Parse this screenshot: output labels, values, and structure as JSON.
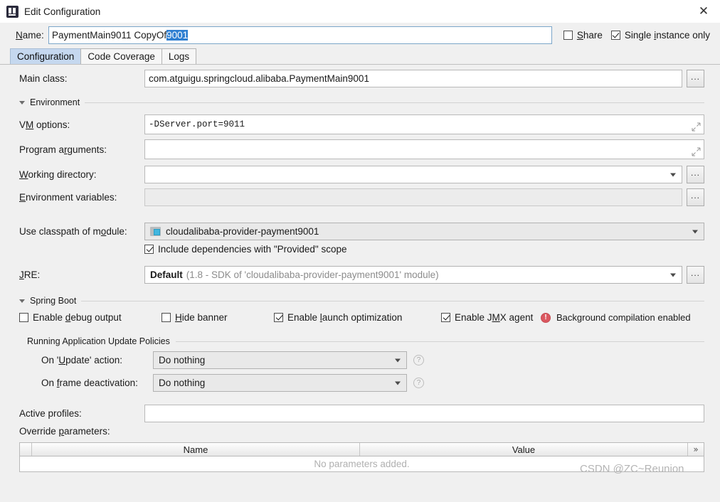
{
  "window": {
    "title": "Edit Configuration",
    "app_icon": "intellij-idea-icon",
    "close_label": "✕"
  },
  "name_row": {
    "label": "Name:",
    "value_plain": "PaymentMain9011 CopyOf ",
    "value_selected": "9001",
    "share": {
      "label": "Share",
      "mnemonic": "S",
      "checked": false
    },
    "single_instance": {
      "label": "Single instance only",
      "pre": "Single ",
      "mnemonic": "i",
      "post": "nstance only",
      "checked": true
    }
  },
  "tabs": [
    {
      "label": "Configuration",
      "active": true
    },
    {
      "label": "Code Coverage",
      "active": false
    },
    {
      "label": "Logs",
      "active": false
    }
  ],
  "fields": {
    "main_class": {
      "label": "Main class:",
      "value": "com.atguigu.springcloud.alibaba.PaymentMain9001",
      "browse": "..."
    },
    "vm_options": {
      "label_pre": "V",
      "label_mn": "M",
      "label_post": " options:",
      "label": "VM options:",
      "value": "-DServer.port=9011",
      "expand_icon": "expand-icon"
    },
    "program_arguments": {
      "label_pre": "Program a",
      "label_mn": "r",
      "label_post": "guments:",
      "label": "Program arguments:",
      "value": "",
      "expand_icon": "expand-icon"
    },
    "working_directory": {
      "label_pre": "",
      "label_mn": "W",
      "label_post": "orking directory:",
      "label": "Working directory:",
      "value": "",
      "browse": "..."
    },
    "environment_variables": {
      "label_pre": "",
      "label_mn": "E",
      "label_post": "nvironment variables:",
      "label": "Environment variables:",
      "value": "",
      "browse": "...",
      "disabled": true
    },
    "classpath_module": {
      "label_pre": "Use classpath of m",
      "label_mn": "o",
      "label_post": "dule:",
      "label": "Use classpath of module:",
      "value": "cloudalibaba-provider-payment9001",
      "icon": "module-icon"
    },
    "include_provided": {
      "label": "Include dependencies with \"Provided\" scope",
      "checked": true
    },
    "jre": {
      "label_pre": "",
      "label_mn": "J",
      "label_post": "RE:",
      "label": "JRE:",
      "value_bold": "Default",
      "value_gray": "(1.8 - SDK of 'cloudalibaba-provider-payment9001' module)",
      "browse": "..."
    },
    "active_profiles": {
      "label": "Active profiles:",
      "value": ""
    },
    "override_parameters": {
      "label_pre": "Override ",
      "label_mn": "p",
      "label_post": "arameters:",
      "label": "Override parameters:"
    }
  },
  "sections": {
    "environment": {
      "title": "Environment",
      "expanded": true
    },
    "spring_boot": {
      "title": "Spring Boot",
      "expanded": true
    },
    "update_policies": {
      "title": "Running Application Update Policies"
    }
  },
  "spring_boot_options": [
    {
      "name": "enable-debug-output",
      "pre": "Enable ",
      "mn": "d",
      "post": "ebug output",
      "label": "Enable debug output",
      "checked": false
    },
    {
      "name": "hide-banner",
      "pre": "",
      "mn": "H",
      "post": "ide banner",
      "label": "Hide banner",
      "checked": false
    },
    {
      "name": "enable-launch-optimization",
      "pre": "Enable ",
      "mn": "l",
      "post": "aunch optimization",
      "label": "Enable launch optimization",
      "checked": true
    },
    {
      "name": "enable-jmx-agent",
      "pre": "Enable J",
      "mn": "M",
      "post": "X agent",
      "label": "Enable JMX agent",
      "checked": true
    }
  ],
  "background_compilation": {
    "icon": "warning-icon",
    "label": "Background compilation enabled"
  },
  "update_policy_rows": [
    {
      "label_pre": "On '",
      "label_mn": "U",
      "label_post": "pdate' action:",
      "label": "On 'Update' action:",
      "value": "Do nothing",
      "help": "?"
    },
    {
      "label_pre": "On ",
      "label_mn": "f",
      "label_post": "rame deactivation:",
      "label": "On frame deactivation:",
      "value": "Do nothing",
      "help": "?"
    }
  ],
  "parameters_table": {
    "columns": [
      "Name",
      "Value"
    ],
    "expand_label": "»",
    "empty_text": "No parameters added."
  },
  "watermark": "CSDN @ZC~Reunion",
  "colors": {
    "accent": "#2f7fd1",
    "tab_active": "#c5d8ef",
    "warning": "#db5860",
    "module_accent": "#40b6e0"
  }
}
